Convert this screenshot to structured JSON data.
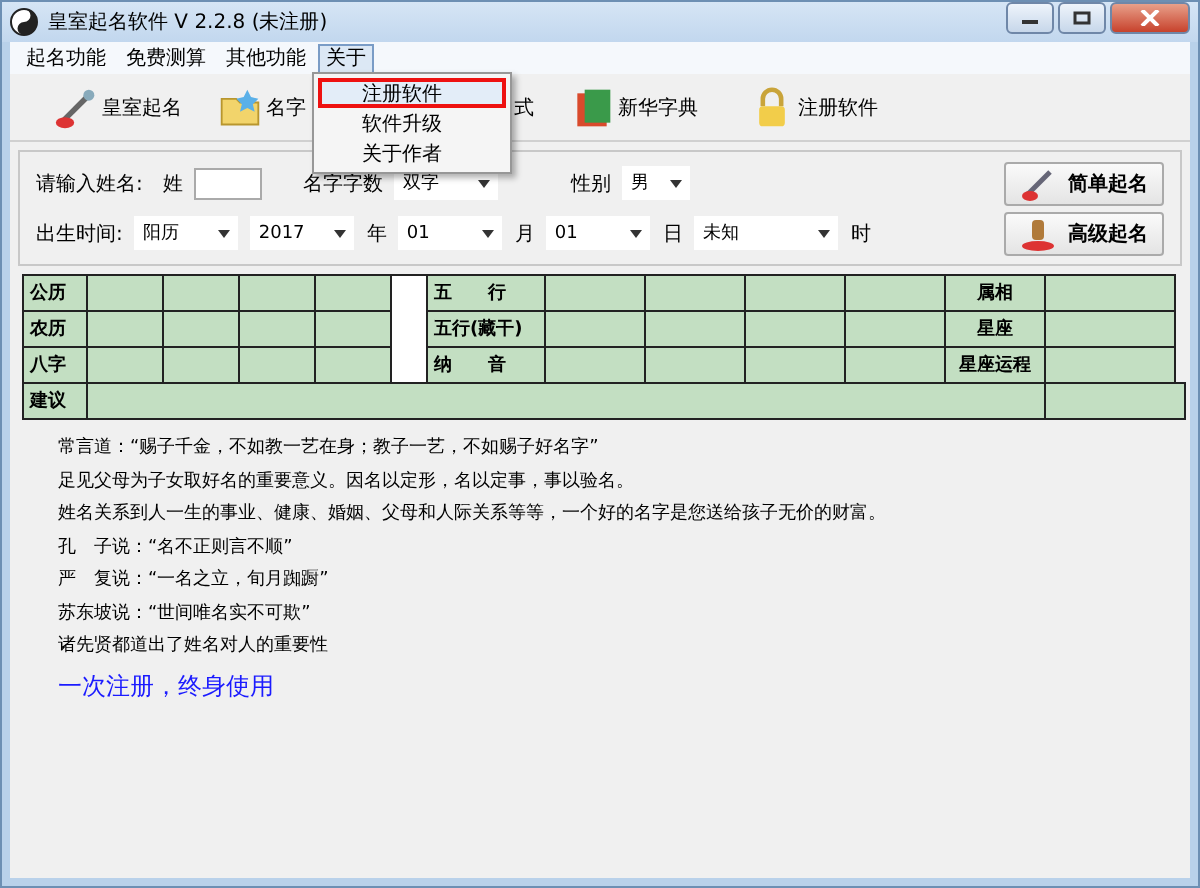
{
  "window": {
    "title": "皇室起名软件 V 2.2.8 (未注册)"
  },
  "menu": [
    {
      "label": "起名功能",
      "selected": false
    },
    {
      "label": "免费测算",
      "selected": false
    },
    {
      "label": "其他功能",
      "selected": false
    },
    {
      "label": "关于",
      "selected": true
    }
  ],
  "dropdown": [
    {
      "label": "注册软件",
      "selected": true
    },
    {
      "label": "软件升级",
      "selected": false
    },
    {
      "label": "关于作者",
      "selected": false
    }
  ],
  "toolbar": [
    {
      "label": "皇室起名"
    },
    {
      "label": "名字"
    },
    {
      "label": "式"
    },
    {
      "label": "新华字典"
    },
    {
      "label": "注册软件"
    }
  ],
  "form": {
    "name_label": "请输入姓名:",
    "surname_label": "姓",
    "count_label": "名字字数",
    "count_value": "双字",
    "gender_label": "性别",
    "gender_value": "男",
    "birth_label": "出生时间:",
    "calendar": "阳历",
    "year": "2017",
    "year_unit": "年",
    "month": "01",
    "month_unit": "月",
    "day": "01",
    "day_unit": "日",
    "hour": "未知",
    "hour_unit": "时"
  },
  "buttons": [
    {
      "label": "简单起名"
    },
    {
      "label": "高级起名"
    }
  ],
  "grid": {
    "rows": [
      {
        "left": "公历",
        "mid": "五　　行",
        "right": "属相"
      },
      {
        "left": "农历",
        "mid": "五行(藏干)",
        "right": "星座"
      },
      {
        "left": "八字",
        "mid": "纳　　音",
        "right": "星座运程"
      }
    ],
    "advice": "建议"
  },
  "lines": [
    "常言道：“赐子千金，不如教一艺在身；教子一艺，不如赐子好名字”",
    "足见父母为子女取好名的重要意义。因名以定形，名以定事，事以验名。",
    "姓名关系到人一生的事业、健康、婚姻、父母和人际关系等等，一个好的名字是您送给孩子无价的财富。",
    "孔　子说：“名不正则言不顺”",
    "严　复说：“一名之立，旬月踟蹰”",
    "苏东坡说：“世间唯名实不可欺”",
    "诸先贤都道出了姓名对人的重要性"
  ],
  "promo": "一次注册，终身使用"
}
